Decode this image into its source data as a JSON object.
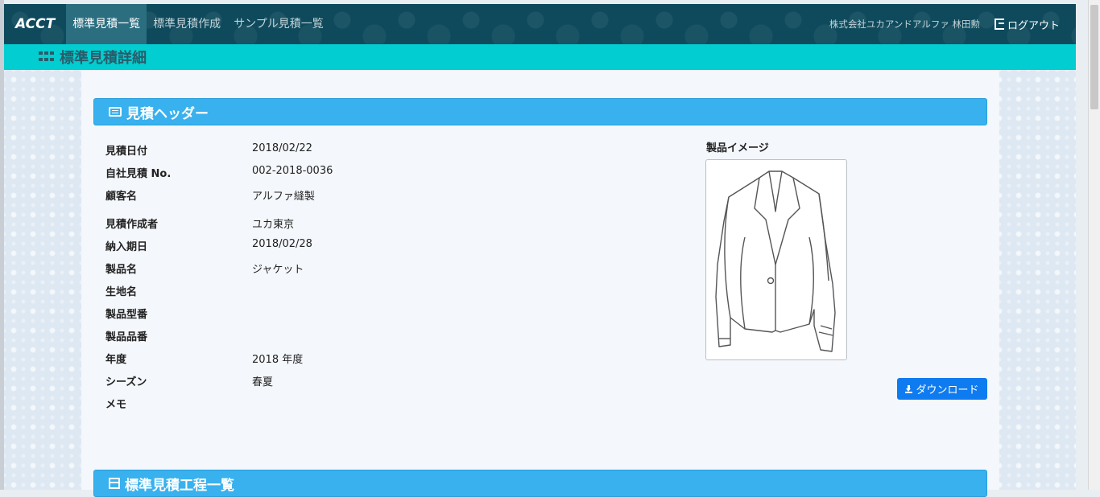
{
  "navbar": {
    "brand": "ACCT",
    "items": [
      {
        "label": "標準見積一覧"
      },
      {
        "label": "標準見積作成"
      },
      {
        "label": "サンプル見積一覧"
      }
    ],
    "company_user": "株式会社ユカアンドアルファ 林田勲",
    "logout_label": "ログアウト"
  },
  "subbar": {
    "title": "標準見積詳細"
  },
  "header_panel": {
    "title": "見積ヘッダー"
  },
  "fields": [
    {
      "label": "見積日付",
      "value": "2018/02/22"
    },
    {
      "label": "自社見積 No.",
      "value": "002-2018-0036"
    },
    {
      "label": "顧客名",
      "value": "アルファ縫製"
    },
    {
      "label": "見積作成者",
      "value": "ユカ東京"
    },
    {
      "label": "納入期日",
      "value": "2018/02/28"
    },
    {
      "label": "製品名",
      "value": "ジャケット"
    },
    {
      "label": "生地名",
      "value": ""
    },
    {
      "label": "製品型番",
      "value": ""
    },
    {
      "label": "製品品番",
      "value": ""
    },
    {
      "label": "年度",
      "value": "2018 年度"
    },
    {
      "label": "シーズン",
      "value": "春夏"
    },
    {
      "label": "メモ",
      "value": ""
    }
  ],
  "product_image": {
    "label": "製品イメージ"
  },
  "download_label": "ダウンロード",
  "process_panel": {
    "title": "標準見積工程一覧"
  }
}
